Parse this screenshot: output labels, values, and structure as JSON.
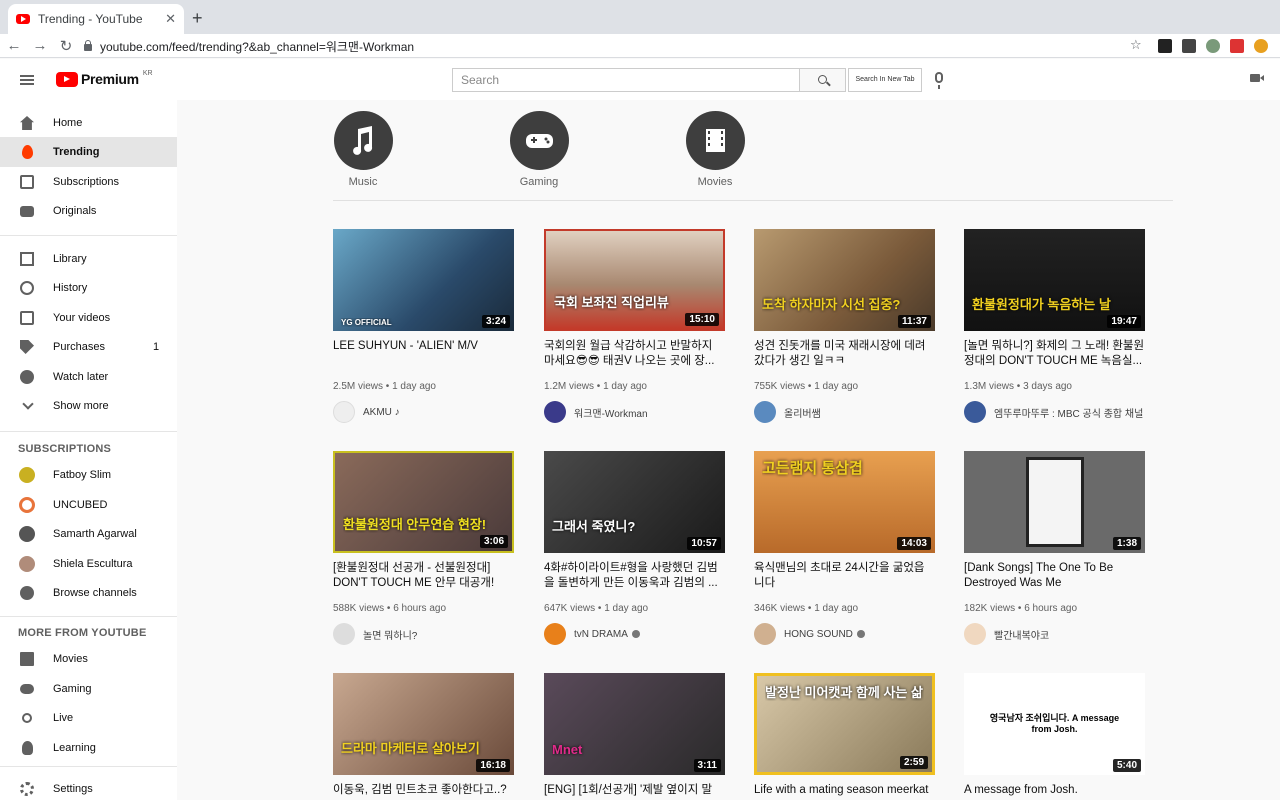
{
  "browser": {
    "tab_title": "Trending - YouTube",
    "tab_close": "✕",
    "new_tab": "+",
    "url": "youtube.com/feed/trending?&ab_channel=워크맨-Workman",
    "back": "←",
    "forward": "→",
    "reload": "↻",
    "star": "☆"
  },
  "header": {
    "logo_text": "Premium",
    "region": "KR",
    "search_placeholder": "Search",
    "new_tab_label": "Search In New Tab"
  },
  "sidebar": {
    "items": [
      {
        "label": "Home",
        "icon": "home-icon"
      },
      {
        "label": "Trending",
        "icon": "trending-icon"
      },
      {
        "label": "Subscriptions",
        "icon": "subscriptions-icon"
      },
      {
        "label": "Originals",
        "icon": "originals-icon"
      },
      {
        "label": "Library",
        "icon": "library-icon"
      },
      {
        "label": "History",
        "icon": "history-icon"
      },
      {
        "label": "Your videos",
        "icon": "your-videos-icon"
      },
      {
        "label": "Purchases",
        "icon": "purchases-icon",
        "count": "1"
      },
      {
        "label": "Watch later",
        "icon": "watch-later-icon"
      },
      {
        "label": "Show more",
        "icon": "chevron-down-icon"
      }
    ],
    "subscriptions_heading": "SUBSCRIPTIONS",
    "subscriptions": [
      {
        "label": "Fatboy Slim",
        "color": "#c9b021"
      },
      {
        "label": "UNCUBED",
        "color": "#e8743b"
      },
      {
        "label": "Samarth Agarwal",
        "color": "#555555"
      },
      {
        "label": "Shiela Escultura",
        "color": "#b08c7a"
      },
      {
        "label": "Browse channels",
        "icon": "add-circle-icon"
      }
    ],
    "more_heading": "MORE FROM YOUTUBE",
    "more": [
      {
        "label": "Movies",
        "icon": "movies-icon"
      },
      {
        "label": "Gaming",
        "icon": "gaming-icon"
      },
      {
        "label": "Live",
        "icon": "live-icon"
      },
      {
        "label": "Learning",
        "icon": "learning-icon"
      }
    ],
    "settings": "Settings"
  },
  "categories": [
    {
      "label": "Music",
      "icon": "music-note-icon"
    },
    {
      "label": "Gaming",
      "icon": "game-controller-icon"
    },
    {
      "label": "Movies",
      "icon": "film-icon"
    }
  ],
  "videos": [
    {
      "title": "LEE SUHYUN - 'ALIEN' M/V",
      "meta": "2.5M views • 1 day ago",
      "channel": "AKMU ♪",
      "duration": "3:24",
      "thumb_color": "#3a5a7a",
      "thumb_text": "YG OFFICIAL",
      "avatar_color": "#eeeeee",
      "verified": false
    },
    {
      "title": "국회의원 월급 삭감하시고 반말하지 마세요😎😎 태권V 나오는 곳에 장...",
      "meta": "1.2M views • 1 day ago",
      "channel": "워크맨-Workman",
      "duration": "15:10",
      "thumb_color": "#c33a2a",
      "thumb_text": "국회 보좌진 직업리뷰",
      "avatar_color": "#3a3a8a",
      "verified": false
    },
    {
      "title": "성견 진돗개를 미국 재래시장에 데려갔다가 생긴 일ㅋㅋ",
      "meta": "755K views • 1 day ago",
      "channel": "올리버쌤",
      "duration": "11:37",
      "thumb_color": "#8a6a4a",
      "thumb_text": "도착 하자마자 시선 집중?",
      "avatar_color": "#5a8abf",
      "verified": false
    },
    {
      "title": "[놀면 뭐하니?] 화제의 그 노래! 환불원정대의 DON'T TOUCH ME 녹음실...",
      "meta": "1.3M views • 3 days ago",
      "channel": "엠뚜루마뚜루 : MBC 공식 종합 채널",
      "duration": "19:47",
      "thumb_color": "#1a1a1a",
      "thumb_text": "환불원정대가 녹음하는 날",
      "avatar_color": "#3a5a9a",
      "verified": false
    },
    {
      "title": "[환불원정대 선공개 - 선불원정대] DON'T TOUCH ME 안무 대공개!(fea...",
      "meta": "588K views • 6 hours ago",
      "channel": "놀면 뭐하니?",
      "duration": "3:06",
      "thumb_color": "#6a4a3a",
      "thumb_text": "환불원정대 안무연습 현장!",
      "avatar_color": "#dddddd",
      "verified": false
    },
    {
      "title": "4화#하이라이트#형을 사랑했던 김범을 돌변하게 만든 이동욱과 김범의 ...",
      "meta": "647K views • 1 day ago",
      "channel": "tvN DRAMA",
      "duration": "10:57",
      "thumb_color": "#2a2a2a",
      "thumb_text": "그래서 죽였니?",
      "avatar_color": "#e8801a",
      "verified": true
    },
    {
      "title": "육식맨님의 초대로 24시간을 굶었읍니다",
      "meta": "346K views • 1 day ago",
      "channel": "HONG SOUND",
      "duration": "14:03",
      "thumb_color": "#c87a3a",
      "thumb_text": "고든램지 통삼겹",
      "avatar_color": "#d0b090",
      "verified": true
    },
    {
      "title": "[Dank Songs] The One To Be Destroyed Was Me",
      "meta": "182K views • 6 hours ago",
      "channel": "빨간내복야코",
      "duration": "1:38",
      "thumb_color": "#6a6a6a",
      "thumb_text": "",
      "avatar_color": "#f0d8c0",
      "verified": false
    },
    {
      "title": "이동욱, 김범 민트초코 좋아한다고..?",
      "meta": "",
      "channel": "",
      "duration": "16:18",
      "thumb_color": "#8a6a5a",
      "thumb_text": "드라마 마케터로 살아보기",
      "avatar_color": "#dddddd",
      "verified": false
    },
    {
      "title": "[ENG] [1회/선공개] '제발 옆이지 말",
      "meta": "",
      "channel": "",
      "duration": "3:11",
      "thumb_color": "#3a3a3a",
      "thumb_text": "Mnet",
      "avatar_color": "#dddddd",
      "verified": false
    },
    {
      "title": "Life with a mating season meerkat",
      "meta": "",
      "channel": "",
      "duration": "2:59",
      "thumb_color": "#b8a070",
      "thumb_text": "발정난 미어캣과 함께 사는 삶",
      "avatar_color": "#dddddd",
      "verified": false
    },
    {
      "title": "A message from Josh.",
      "meta": "",
      "channel": "",
      "duration": "5:40",
      "thumb_color": "#ffffff",
      "thumb_text": "영국남자 조쉬입니다. A message from Josh.",
      "avatar_color": "#dddddd",
      "verified": false
    }
  ]
}
